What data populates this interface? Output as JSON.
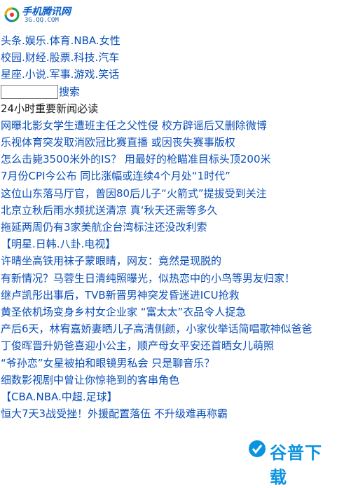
{
  "logo": {
    "title": "手机腾讯网",
    "url": "3G.QQ.COM"
  },
  "nav_rows": [
    [
      "头条",
      "娱乐",
      "体育",
      "NBA",
      "女性"
    ],
    [
      "校园",
      "财经",
      "股票",
      "科技",
      "汽车"
    ],
    [
      "星座",
      "小说",
      "军事",
      "游戏",
      "笑话"
    ]
  ],
  "nav_separator": ".",
  "search": {
    "value": "",
    "button": "搜索"
  },
  "section_main": "24小时重要新闻必读",
  "news_main": [
    "网曝北影女学生遭班主任之父性侵 校方辟谣后又删除微博",
    "乐视体育突发取消欧冠比赛直播 或因丧失赛事版权",
    "怎么击毙3500米外的IS？ 用最好的枪瞄准目标头顶200米",
    "7月份CPI今公布 同比涨幅或连续4个月处“1时代”",
    "这位山东落马厅官，曾因80后儿子“火箭式”提拔受到关注",
    "北京立秋后雨水频扰送清凉 真‘秋天还需等多久",
    "拖延两周仍有3家美航企台湾标注还没改利索"
  ],
  "section_ent": "【明星.日韩.八卦.电视】",
  "news_ent": [
    "许晴坐高铁用袜子蒙眼睛，网友：竟然是现脱的",
    "有新情况？马蓉生日清纯照曝光，似热恋中的小鸟等男友归家！",
    "继卢凯彤出事后，TVB新晋男神突发昏迷进ICU抢救",
    "黄圣依机场变身乡村女企业家 “富太太”衣品令人捉急",
    "产后6天，林宥嘉娇妻晒儿子高清侧颜，小家伙举话简唱歌神似爸爸",
    "丁俊晖晋升奶爸喜迎小公主，顺产母女平安还首晒女儿萌照",
    "“爷孙恋”女星被拍和眼镜男私会 只是聊音乐？",
    "细数影视剧中曾让你惊艳到的客串角色"
  ],
  "section_sport": "【CBA.NBA.中超.足球】",
  "news_sport": [
    "恒大7天3战受挫！外援配置落伍 不升级难再称霸"
  ],
  "watermark": {
    "text": "谷普下载"
  },
  "colors": {
    "link": "#0a4eb8",
    "dark_text": "#1b1b1b",
    "watermark": "#0b93e1"
  }
}
